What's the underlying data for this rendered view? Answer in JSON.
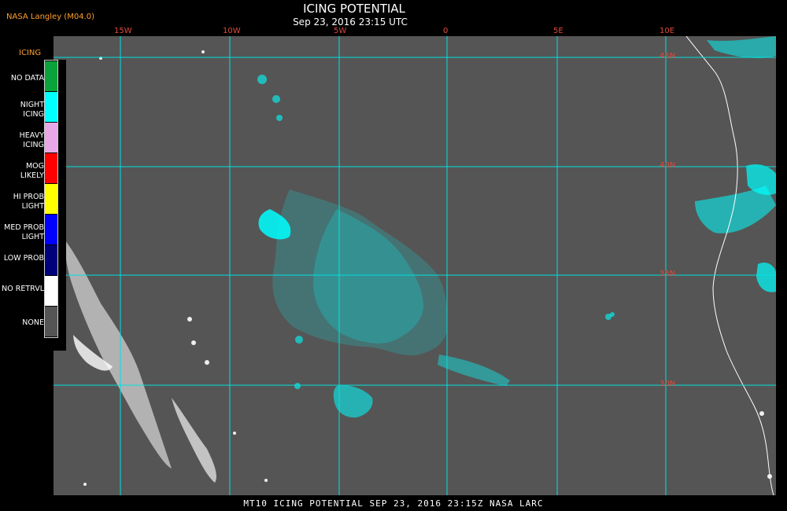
{
  "header": {
    "credit": "NASA Langley (M04.0)",
    "title": "ICING POTENTIAL",
    "timestamp": "Sep 23, 2016 23:15 UTC"
  },
  "legend": {
    "heading": "ICING",
    "items": [
      {
        "label": "NO DATA",
        "color": "#0aa23a"
      },
      {
        "label": "NIGHT ICING",
        "color": "#00ffff"
      },
      {
        "label": "HEAVY ICING",
        "color": "#e6a8e6"
      },
      {
        "label": "MOG LIKELY",
        "color": "#ff0000"
      },
      {
        "label": "HI PROB LIGHT",
        "color": "#ffff00"
      },
      {
        "label": "MED PROB LIGHT",
        "color": "#0000ff"
      },
      {
        "label": "LOW PROB",
        "color": "#00007a"
      },
      {
        "label": "NO RETRVL",
        "color": "#ffffff"
      },
      {
        "label": "NONE",
        "color": "#555555"
      }
    ]
  },
  "map": {
    "longitudes": [
      "15W",
      "10W",
      "5W",
      "0",
      "5E",
      "10E"
    ],
    "latitudes": [
      "45N",
      "40N",
      "35N",
      "30N"
    ]
  },
  "footer": {
    "caption": "MT10  ICING POTENTIAL   SEP 23, 2016 23:15Z   NASA LARC"
  }
}
